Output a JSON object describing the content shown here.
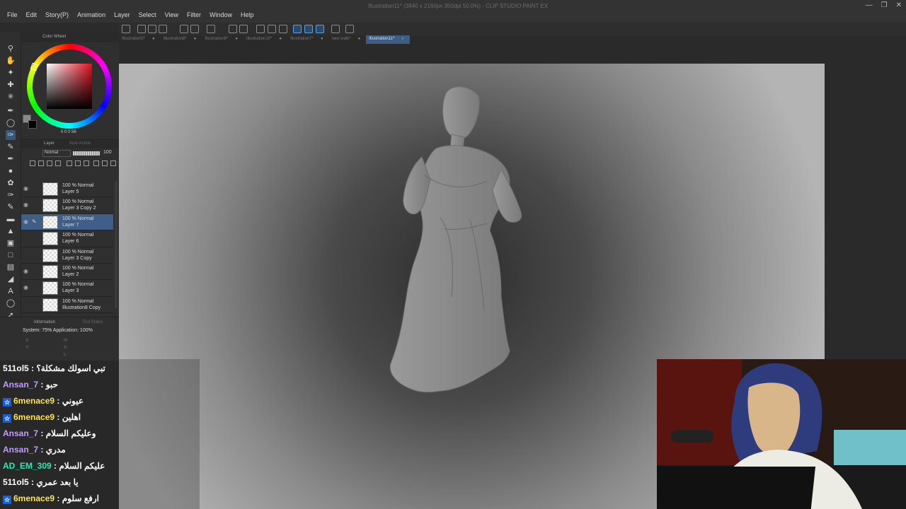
{
  "window": {
    "title": "Illustration11* (3840 x 2160px 350dpi 50.0%) - CLIP STUDIO PAINT EX"
  },
  "menu": [
    "File",
    "Edit",
    "Story(P)",
    "Animation",
    "Layer",
    "Select",
    "View",
    "Filter",
    "Window",
    "Help"
  ],
  "tabs": [
    {
      "label": "Illustration5*",
      "active": false
    },
    {
      "label": "Illustration8*",
      "active": false
    },
    {
      "label": "Illustration9*",
      "active": false
    },
    {
      "label": "Illustration10*",
      "active": false
    },
    {
      "label": "Illustration7*",
      "active": false
    },
    {
      "label": "new walk*",
      "active": false
    },
    {
      "label": "Illustration11*",
      "active": true
    }
  ],
  "color_panel": {
    "title": "Color Wheel",
    "hsv": "0  0  0  56",
    "main_color": "#8a8a8a"
  },
  "layer_panel": {
    "title": "Layer",
    "tab2": "Auto Action",
    "blend_mode": "Normal",
    "opacity": "100",
    "layers": [
      {
        "blend": "100 % Normal",
        "name": "Layer 5",
        "visible": true,
        "selected": false
      },
      {
        "blend": "100 % Normal",
        "name": "Layer 3 Copy 2",
        "visible": true,
        "selected": false
      },
      {
        "blend": "100 % Normal",
        "name": "Layer 7",
        "visible": true,
        "selected": true
      },
      {
        "blend": "100 % Normal",
        "name": "Layer 6",
        "visible": false,
        "selected": false
      },
      {
        "blend": "100 % Normal",
        "name": "Layer 3 Copy",
        "visible": false,
        "selected": false
      },
      {
        "blend": "100 % Normal",
        "name": "Layer 2",
        "visible": true,
        "selected": false
      },
      {
        "blend": "100 % Normal",
        "name": "Layer 3",
        "visible": true,
        "selected": false
      },
      {
        "blend": "100 % Normal",
        "name": "Illustration8 Copy",
        "visible": false,
        "selected": false
      }
    ]
  },
  "info_panel": {
    "title": "Information",
    "tab2": "Tool Status",
    "system": "System: 75% Application: 100%",
    "x": "X:",
    "y": "Y:",
    "h": "H:",
    "v": "V:",
    "l": "L:"
  },
  "chat": [
    {
      "user": "511ol5",
      "color": "#ffffff",
      "badge": false,
      "text": "تبي اسولك مشكلة؟"
    },
    {
      "user": "Ansan_7",
      "color": "#c39bff",
      "badge": false,
      "text": "حبو"
    },
    {
      "user": "6menace9",
      "color": "#ffe34d",
      "badge": true,
      "text": "عيوني"
    },
    {
      "user": "6menace9",
      "color": "#ffe34d",
      "badge": true,
      "text": "اهلين"
    },
    {
      "user": "Ansan_7",
      "color": "#c39bff",
      "badge": false,
      "text": "وعليكم السلام"
    },
    {
      "user": "Ansan_7",
      "color": "#c39bff",
      "badge": false,
      "text": "مدري"
    },
    {
      "user": "AD_EM_309",
      "color": "#2ee8b0",
      "badge": false,
      "text": "عليكم السلام"
    },
    {
      "user": "511ol5",
      "color": "#ffffff",
      "badge": false,
      "text": "يا بعد عمري"
    },
    {
      "user": "6menace9",
      "color": "#ffe34d",
      "badge": true,
      "text": "ارفع سلوم"
    }
  ]
}
